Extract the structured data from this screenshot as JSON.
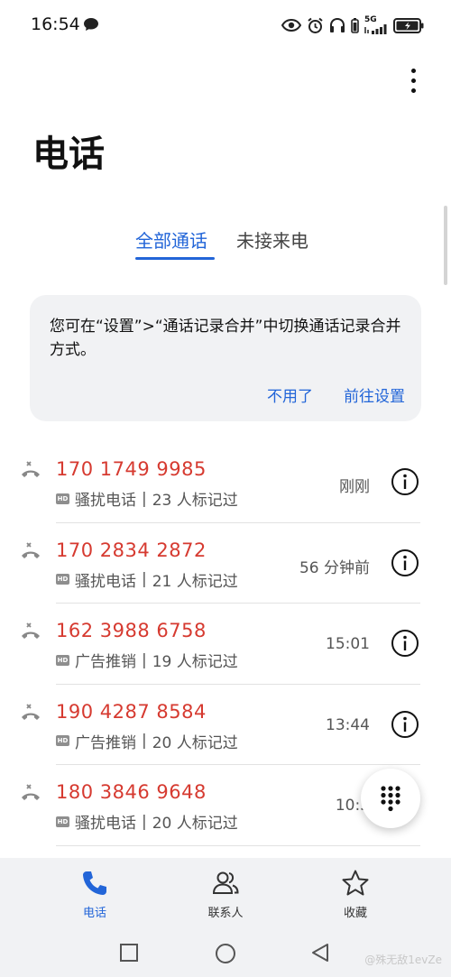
{
  "status_bar": {
    "time": "16:54",
    "network": "5G"
  },
  "header": {
    "title": "电话",
    "more_icon": "more-vertical-icon"
  },
  "tabs": [
    {
      "label": "全部通话",
      "active": true
    },
    {
      "label": "未接来电",
      "active": false
    }
  ],
  "tip_card": {
    "text": "您可在“设置”>“通话记录合并”中切换通话记录合并方式。",
    "dismiss_label": "不用了",
    "settings_label": "前往设置"
  },
  "calls": [
    {
      "number": "170 1749 9985",
      "tag": "骚扰电话",
      "marked": "23 人标记过",
      "time": "刚刚"
    },
    {
      "number": "170 2834 2872",
      "tag": "骚扰电话",
      "marked": "21 人标记过",
      "time": "56 分钟前"
    },
    {
      "number": "162 3988 6758",
      "tag": "广告推销",
      "marked": "19 人标记过",
      "time": "15:01"
    },
    {
      "number": "190 4287 8584",
      "tag": "广告推销",
      "marked": "20 人标记过",
      "time": "13:44"
    },
    {
      "number": "180 3846 9648",
      "tag": "骚扰电话",
      "marked": "20 人标记过",
      "time": "10:5"
    }
  ],
  "hd_badge": "HD",
  "separator": "|",
  "bottom_nav": [
    {
      "label": "电话",
      "icon": "phone-icon",
      "active": true
    },
    {
      "label": "联系人",
      "icon": "contacts-icon",
      "active": false
    },
    {
      "label": "收藏",
      "icon": "star-icon",
      "active": false
    }
  ],
  "watermark": "@殊无敌1evZe",
  "colors": {
    "accent": "#2265d8",
    "missed": "#d63a30",
    "card_bg": "#f1f2f4"
  }
}
